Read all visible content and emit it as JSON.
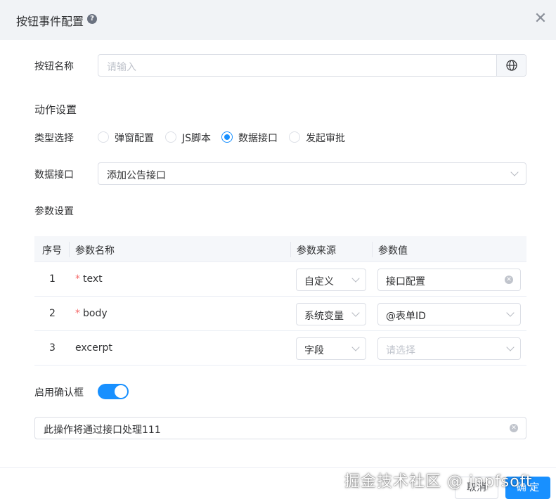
{
  "dialog": {
    "title": "按钮事件配置",
    "help_icon": "help-circle-icon",
    "close_icon": "close-icon"
  },
  "button_name": {
    "label": "按钮名称",
    "placeholder": "请输入",
    "append_icon": "globe-icon"
  },
  "action": {
    "section_title": "动作设置",
    "type_label": "类型选择",
    "types": [
      {
        "label": "弹窗配置",
        "checked": false
      },
      {
        "label": "JS脚本",
        "checked": false
      },
      {
        "label": "数据接口",
        "checked": true
      },
      {
        "label": "发起审批",
        "checked": false
      }
    ],
    "api_label": "数据接口",
    "api_value": "添加公告接口"
  },
  "params": {
    "section_title": "参数设置",
    "columns": [
      "序号",
      "参数名称",
      "参数来源",
      "参数值"
    ],
    "rows": [
      {
        "index": "1",
        "name": "text",
        "required": true,
        "source": "自定义",
        "value": "接口配置",
        "value_placeholder": false
      },
      {
        "index": "2",
        "name": "body",
        "required": true,
        "source": "系统变量",
        "value": "@表单ID",
        "value_placeholder": false
      },
      {
        "index": "3",
        "name": "excerpt",
        "required": false,
        "source": "字段",
        "value": "请选择",
        "value_placeholder": true
      }
    ]
  },
  "confirm": {
    "label": "启用确认框",
    "enabled": true,
    "message": "此操作将通过接口处理111"
  },
  "footer": {
    "cancel_label": "取消",
    "ok_label": "确 定"
  },
  "watermark": "掘金技术社区 @ jnpfsoft",
  "colors": {
    "primary": "#1890ff",
    "header_bg": "#f1f3f6",
    "required": "#f56c6c",
    "border": "#dcdfe6"
  }
}
